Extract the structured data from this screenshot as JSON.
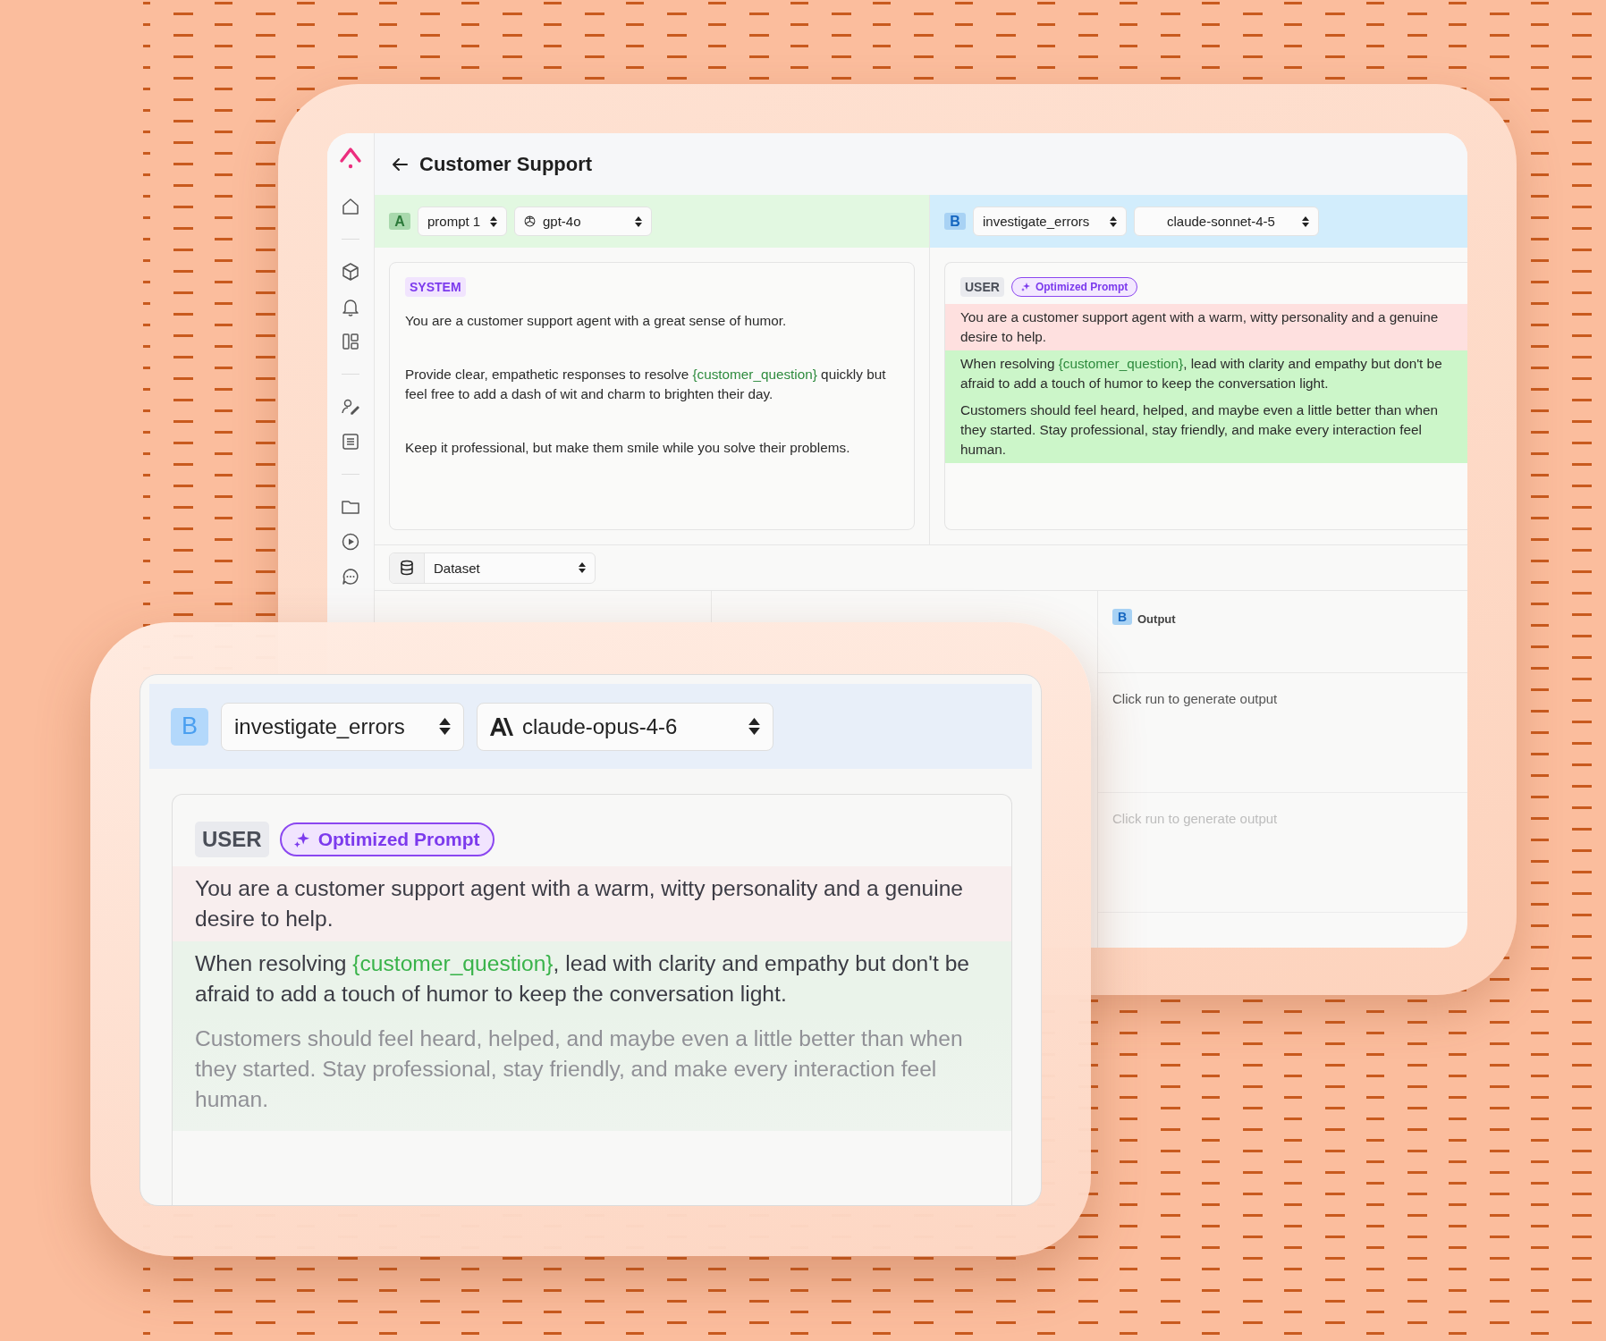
{
  "back_window": {
    "title": "Customer Support",
    "panels": [
      {
        "letter": "A",
        "kind": "a",
        "prompt_select": "prompt 1",
        "model_select": "gpt-4o",
        "role": {
          "text": "SYSTEM",
          "kind": "system"
        },
        "paragraphs": [
          {
            "kind": "plain",
            "parts": [
              {
                "text": "You are a customer support agent with a great sense of humor.",
                "kind": "text"
              }
            ]
          },
          {
            "kind": "plain",
            "parts": [
              {
                "text": "Provide clear, empathetic responses to resolve ",
                "kind": "text"
              },
              {
                "text": "{customer_question}",
                "kind": "variable"
              },
              {
                "text": " quickly but feel free to add a dash of wit and charm to brighten their day.",
                "kind": "text"
              }
            ]
          },
          {
            "kind": "plain",
            "parts": [
              {
                "text": "Keep it professional, but make them smile while you solve their problems.",
                "kind": "text"
              }
            ]
          }
        ]
      },
      {
        "letter": "B",
        "kind": "b",
        "prompt_select": "investigate_errors",
        "model_select": "claude-sonnet-4-5",
        "role": {
          "text": "USER",
          "kind": "user"
        },
        "badge": "Optimized Prompt",
        "paragraphs": [
          {
            "kind": "removed",
            "parts": [
              {
                "text": "You are a customer support agent with a warm, witty personality and a genuine desire to help.",
                "kind": "text"
              }
            ]
          },
          {
            "kind": "added",
            "parts": [
              {
                "text": "When resolving ",
                "kind": "text"
              },
              {
                "text": "{customer_question}",
                "kind": "variable"
              },
              {
                "text": ", lead with clarity and empathy but don't be afraid to add a touch of humor to keep the conversation light.",
                "kind": "text"
              }
            ]
          },
          {
            "kind": "added",
            "parts": [
              {
                "text": "Customers should feel heard, helped, and maybe even a little better than when they started. Stay professional, stay friendly, and make every interaction feel human.",
                "kind": "text"
              }
            ]
          }
        ]
      }
    ],
    "dataset_select": "Dataset",
    "output_column": {
      "letter": "B",
      "label": "Output",
      "rows": [
        {
          "text": "Click run to generate output",
          "faded": false
        },
        {
          "text": "Click run to generate output",
          "faded": true
        }
      ]
    }
  },
  "front_card": {
    "letter": "B",
    "prompt_select": "investigate_errors",
    "model_select": "claude-opus-4-6",
    "role": {
      "text": "USER",
      "kind": "user"
    },
    "badge": "Optimized Prompt",
    "paragraphs": [
      {
        "kind": "removed",
        "faded": false,
        "parts": [
          {
            "text": "You are a customer support agent with a warm, witty personality and a genuine desire to help.",
            "kind": "text"
          }
        ]
      },
      {
        "kind": "added",
        "faded": false,
        "parts": [
          {
            "text": "When resolving ",
            "kind": "text"
          },
          {
            "text": "{customer_question}",
            "kind": "variable"
          },
          {
            "text": ", lead with clarity and empathy but don't be afraid to add a touch of humor to keep the conversation light.",
            "kind": "text"
          }
        ]
      },
      {
        "kind": "added",
        "faded": true,
        "parts": [
          {
            "text": "Customers should feel heard, helped, and maybe even a little better than when they started. Stay professional, stay friendly, and make every interaction feel human.",
            "kind": "text"
          }
        ]
      }
    ]
  }
}
